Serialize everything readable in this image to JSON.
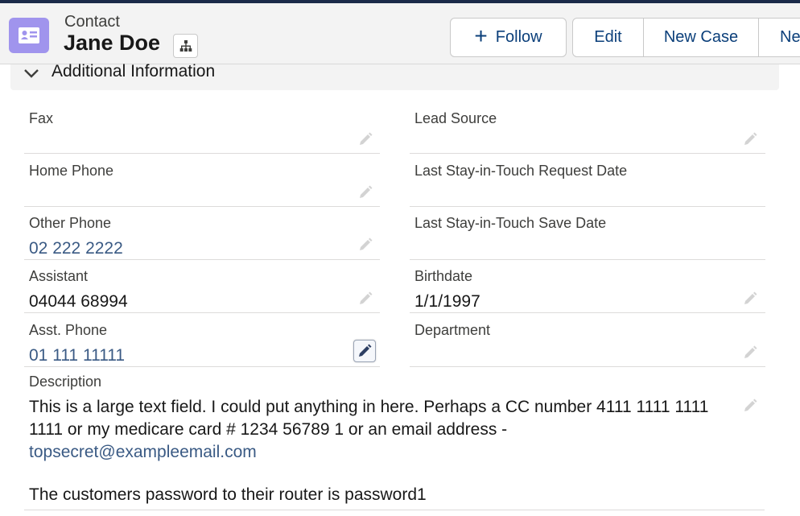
{
  "header": {
    "entity_type": "Contact",
    "record_name": "Jane Doe",
    "icon": "contact-card-icon",
    "hierarchy_icon": "hierarchy-icon"
  },
  "actions": {
    "follow_label": "Follow",
    "edit_label": "Edit",
    "new_case_label": "New Case",
    "more_label": "Ne"
  },
  "section": {
    "title": "Additional Information",
    "toggle_icon": "chevron-down-icon"
  },
  "fields": {
    "fax": {
      "label": "Fax",
      "value": ""
    },
    "home_phone": {
      "label": "Home Phone",
      "value": ""
    },
    "other_phone": {
      "label": "Other Phone",
      "value": "02 222 2222"
    },
    "assistant": {
      "label": "Assistant",
      "value": "04044 68994"
    },
    "asst_phone": {
      "label": "Asst. Phone",
      "value": "01 111 11111"
    },
    "lead_source": {
      "label": "Lead Source",
      "value": ""
    },
    "last_stay_in_touch_request_date": {
      "label": "Last Stay-in-Touch Request Date",
      "value": ""
    },
    "last_stay_in_touch_save_date": {
      "label": "Last Stay-in-Touch Save Date",
      "value": ""
    },
    "birthdate": {
      "label": "Birthdate",
      "value": "1/1/1997"
    },
    "department": {
      "label": "Department",
      "value": ""
    }
  },
  "description": {
    "label": "Description",
    "line1": "This is a large text field. I could put anything in here. Perhaps a CC number 4111 1111 1111 1111 or my medicare card # 1234 56789 1 or an email address -",
    "email": "topsecret@exampleemail.com",
    "line2": "The customers password to their router is password1"
  },
  "colors": {
    "brand_dark": "#1b2a49",
    "entity_icon_bg": "#a094ed",
    "link": "#3a5a84",
    "button_text": "#0b3f7a"
  }
}
